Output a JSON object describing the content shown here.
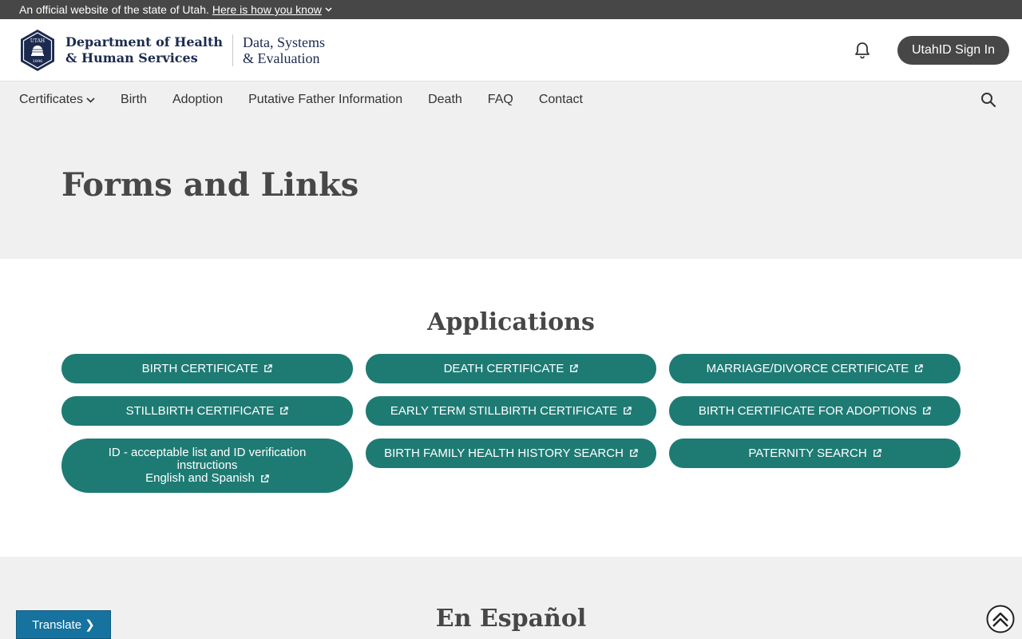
{
  "banner": {
    "official_text": "An official website of the state of Utah.",
    "how_link": "Here is how you know"
  },
  "header": {
    "agency_line1": "Department of Health",
    "agency_line2": "& Human Services",
    "division_line1": "Data, Systems",
    "division_line2": "& Evaluation",
    "seal_text_top": "UTAH",
    "seal_text_bottom": "1896",
    "signin_label": "UtahID Sign In"
  },
  "nav": {
    "items": [
      {
        "label": "Certificates"
      },
      {
        "label": "Birth"
      },
      {
        "label": "Adoption"
      },
      {
        "label": "Putative Father Information"
      },
      {
        "label": "Death"
      },
      {
        "label": "FAQ"
      },
      {
        "label": "Contact"
      }
    ]
  },
  "hero": {
    "title": "Forms and Links"
  },
  "applications": {
    "heading": "Applications",
    "buttons": [
      {
        "label": "BIRTH CERTIFICATE"
      },
      {
        "label": "DEATH CERTIFICATE"
      },
      {
        "label": "MARRIAGE/DIVORCE CERTIFICATE"
      },
      {
        "label": "STILLBIRTH CERTIFICATE"
      },
      {
        "label": "EARLY TERM STILLBIRTH CERTIFICATE"
      },
      {
        "label": "BIRTH CERTIFICATE FOR ADOPTIONS"
      },
      {
        "line1": "ID - acceptable list and ID verification",
        "line2": "instructions",
        "line3": "English and Spanish"
      },
      {
        "label": "BIRTH FAMILY HEALTH HISTORY SEARCH"
      },
      {
        "label": "PATERNITY SEARCH"
      }
    ]
  },
  "espanol": {
    "heading": "En Español"
  },
  "widgets": {
    "translate_label": "Translate ❯"
  },
  "colors": {
    "button_teal": "#1e7b74",
    "banner_gray": "#474747",
    "translate_blue": "#1673a0",
    "navy": "#1b2a4e"
  }
}
